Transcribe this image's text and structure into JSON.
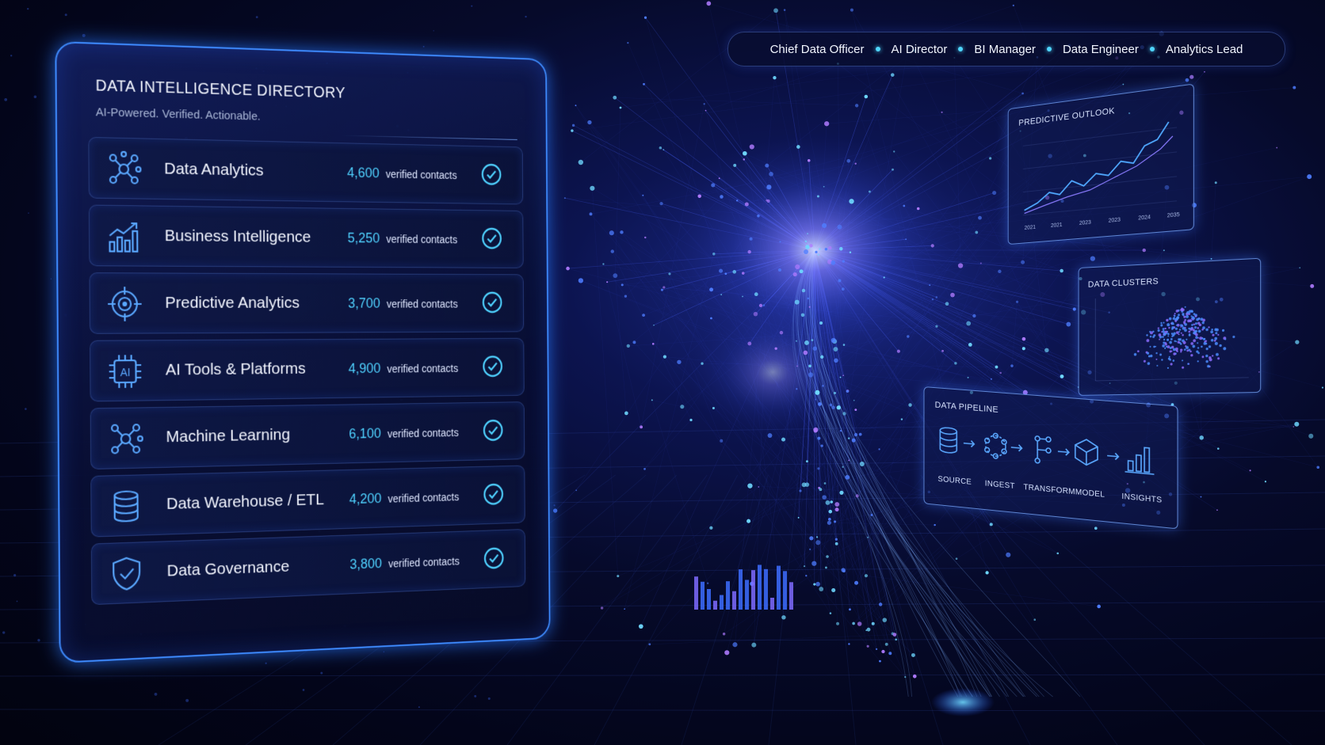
{
  "colors": {
    "accent": "#4fd2ff",
    "panel_border": "#3e8bff",
    "background": "#04061f"
  },
  "roles": [
    "Chief Data Officer",
    "AI Director",
    "BI Manager",
    "Data Engineer",
    "Analytics Lead"
  ],
  "directory": {
    "title": "DATA INTELLIGENCE DIRECTORY",
    "subtitle": "AI-Powered. Verified. Actionable.",
    "unit_label": "verified contacts",
    "items": [
      {
        "label": "Data Analytics",
        "count": "4,600",
        "icon": "network-nodes-icon"
      },
      {
        "label": "Business Intelligence",
        "count": "5,250",
        "icon": "bar-chart-trend-icon"
      },
      {
        "label": "Predictive Analytics",
        "count": "3,700",
        "icon": "target-crosshair-icon"
      },
      {
        "label": "AI Tools & Platforms",
        "count": "4,900",
        "icon": "ai-chip-icon"
      },
      {
        "label": "Machine Learning",
        "count": "6,100",
        "icon": "network-nodes-icon"
      },
      {
        "label": "Data Warehouse / ETL",
        "count": "4,200",
        "icon": "database-icon"
      },
      {
        "label": "Data Governance",
        "count": "3,800",
        "icon": "shield-check-icon"
      }
    ]
  },
  "predictive_card": {
    "title": "PREDICTIVE OUTLOOK",
    "ticks": [
      "2021",
      "2021",
      "2023",
      "2023",
      "2024",
      "2035"
    ]
  },
  "clusters_card": {
    "title": "DATA CLUSTERS"
  },
  "pipeline_card": {
    "title": "DATA PIPELINE",
    "stages": [
      {
        "label": "SOURCE",
        "icon": "database-icon"
      },
      {
        "label": "INGEST",
        "icon": "hexagon-nodes-icon"
      },
      {
        "label": "TRANSFORM",
        "icon": "branch-flow-icon"
      },
      {
        "label": "MODEL",
        "icon": "cube-icon"
      },
      {
        "label": "INSIGHTS",
        "icon": "bar-chart-icon"
      }
    ]
  }
}
